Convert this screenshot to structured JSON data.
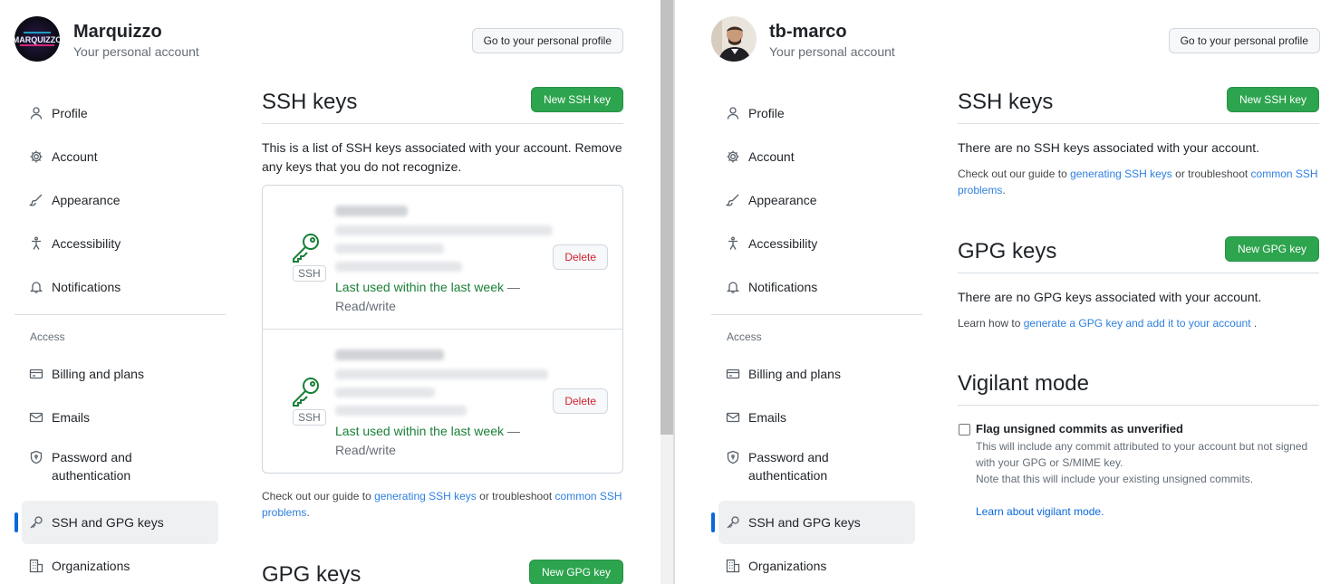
{
  "left": {
    "header": {
      "name": "Marquizzo",
      "subtitle": "Your personal account",
      "profile_button": "Go to your personal profile",
      "avatar_text": "MARQUIZZO"
    },
    "sidebar": {
      "items": [
        {
          "label": "Profile",
          "icon": "person-icon"
        },
        {
          "label": "Account",
          "icon": "gear-icon"
        },
        {
          "label": "Appearance",
          "icon": "paintbrush-icon"
        },
        {
          "label": "Accessibility",
          "icon": "accessibility-icon"
        },
        {
          "label": "Notifications",
          "icon": "bell-icon"
        }
      ],
      "access_heading": "Access",
      "access_items": [
        {
          "label": "Billing and plans",
          "icon": "credit-card-icon"
        },
        {
          "label": "Emails",
          "icon": "mail-icon"
        },
        {
          "label": "Password and authentication",
          "icon": "shield-lock-icon"
        },
        {
          "label": "SSH and GPG keys",
          "icon": "key-icon",
          "active": true
        },
        {
          "label": "Organizations",
          "icon": "organization-icon"
        }
      ]
    },
    "ssh": {
      "title": "SSH keys",
      "new_button": "New SSH key",
      "description": "This is a list of SSH keys associated with your account. Remove any keys that you do not recognize.",
      "keys": [
        {
          "badge": "SSH",
          "last_used": "Last used within the last week",
          "dash": " —",
          "access": "Read/write",
          "delete": "Delete"
        },
        {
          "badge": "SSH",
          "last_used": "Last used within the last week",
          "dash": " —",
          "access": "Read/write",
          "delete": "Delete"
        }
      ],
      "guide_pre": "Check out our guide to ",
      "guide_link": "generating SSH keys",
      "guide_mid": " or troubleshoot ",
      "guide_link2": "common SSH problems",
      "guide_end": "."
    },
    "gpg": {
      "title": "GPG keys",
      "new_button": "New GPG key"
    }
  },
  "right": {
    "header": {
      "name": "tb-marco",
      "subtitle": "Your personal account",
      "profile_button": "Go to your personal profile"
    },
    "sidebar": {
      "items": [
        {
          "label": "Profile"
        },
        {
          "label": "Account"
        },
        {
          "label": "Appearance"
        },
        {
          "label": "Accessibility"
        },
        {
          "label": "Notifications"
        }
      ],
      "access_heading": "Access",
      "access_items": [
        {
          "label": "Billing and plans"
        },
        {
          "label": "Emails"
        },
        {
          "label": "Password and authentication"
        },
        {
          "label": "SSH and GPG keys",
          "active": true
        },
        {
          "label": "Organizations"
        }
      ]
    },
    "ssh": {
      "title": "SSH keys",
      "new_button": "New SSH key",
      "empty": "There are no SSH keys associated with your account.",
      "guide_pre": "Check out our guide to ",
      "guide_link": "generating SSH keys",
      "guide_mid": " or troubleshoot ",
      "guide_link2": "common SSH problems",
      "guide_end": "."
    },
    "gpg": {
      "title": "GPG keys",
      "new_button": "New GPG key",
      "empty": "There are no GPG keys associated with your account.",
      "learn_pre": "Learn how to ",
      "learn_link": "generate a GPG key and add it to your account",
      "learn_end": " ."
    },
    "vigilant": {
      "title": "Vigilant mode",
      "checkbox_label": "Flag unsigned commits as unverified",
      "checked": false,
      "desc1": "This will include any commit attributed to your account but not signed with your GPG or S/MIME key.",
      "desc2": "Note that this will include your existing unsigned commits.",
      "learn_link": "Learn about vigilant mode."
    }
  },
  "colors": {
    "accent": "#0969da",
    "green_button": "#2da44e",
    "danger": "#cf222e",
    "success_text": "#1a7f37"
  }
}
